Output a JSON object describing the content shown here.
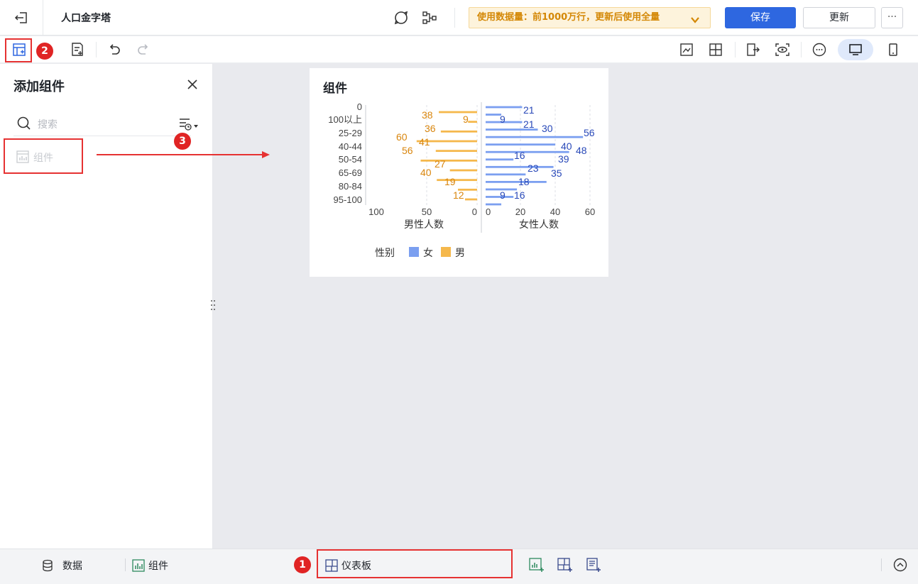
{
  "header": {
    "title": "人口金字塔",
    "data_notice": "使用数据量：前1000万行，更新后使用全量",
    "save_label": "保存",
    "update_label": "更新",
    "more_label": "···"
  },
  "annotations": {
    "badge_1": "1",
    "badge_2": "2",
    "badge_3": "3"
  },
  "left_panel": {
    "title": "添加组件",
    "search_placeholder": "搜索",
    "items": [
      {
        "label": "组件"
      }
    ]
  },
  "widget": {
    "title": "组件"
  },
  "chart_data": {
    "type": "bar",
    "categories": [
      "0",
      "100以上",
      "25-29",
      "40-44",
      "50-54",
      "65-69",
      "80-84",
      "95-100"
    ],
    "left_axis_label": "男性人数",
    "right_axis_label": "女性人数",
    "left_ticks": [
      "100",
      "50",
      "0"
    ],
    "right_ticks": [
      "0",
      "20",
      "40",
      "60"
    ],
    "left_range": [
      0,
      100
    ],
    "right_range": [
      0,
      60
    ],
    "legend_title": "性别",
    "legend_position": "bottom-left",
    "series": [
      {
        "name": "女",
        "color": "#7b9ff0",
        "label_color": "#2848b8",
        "values": [
          21,
          9,
          21,
          30,
          56,
          40,
          48,
          16,
          39,
          23,
          35,
          18,
          16,
          9
        ]
      },
      {
        "name": "男",
        "color": "#f5b84c",
        "label_color": "#d9860e",
        "values": [
          38,
          9,
          36,
          60,
          41,
          56,
          27,
          40,
          19,
          12
        ]
      }
    ]
  },
  "bottom_bar": {
    "data_label": "数据",
    "widget_label": "组件",
    "dashboard_label": "仪表板"
  }
}
